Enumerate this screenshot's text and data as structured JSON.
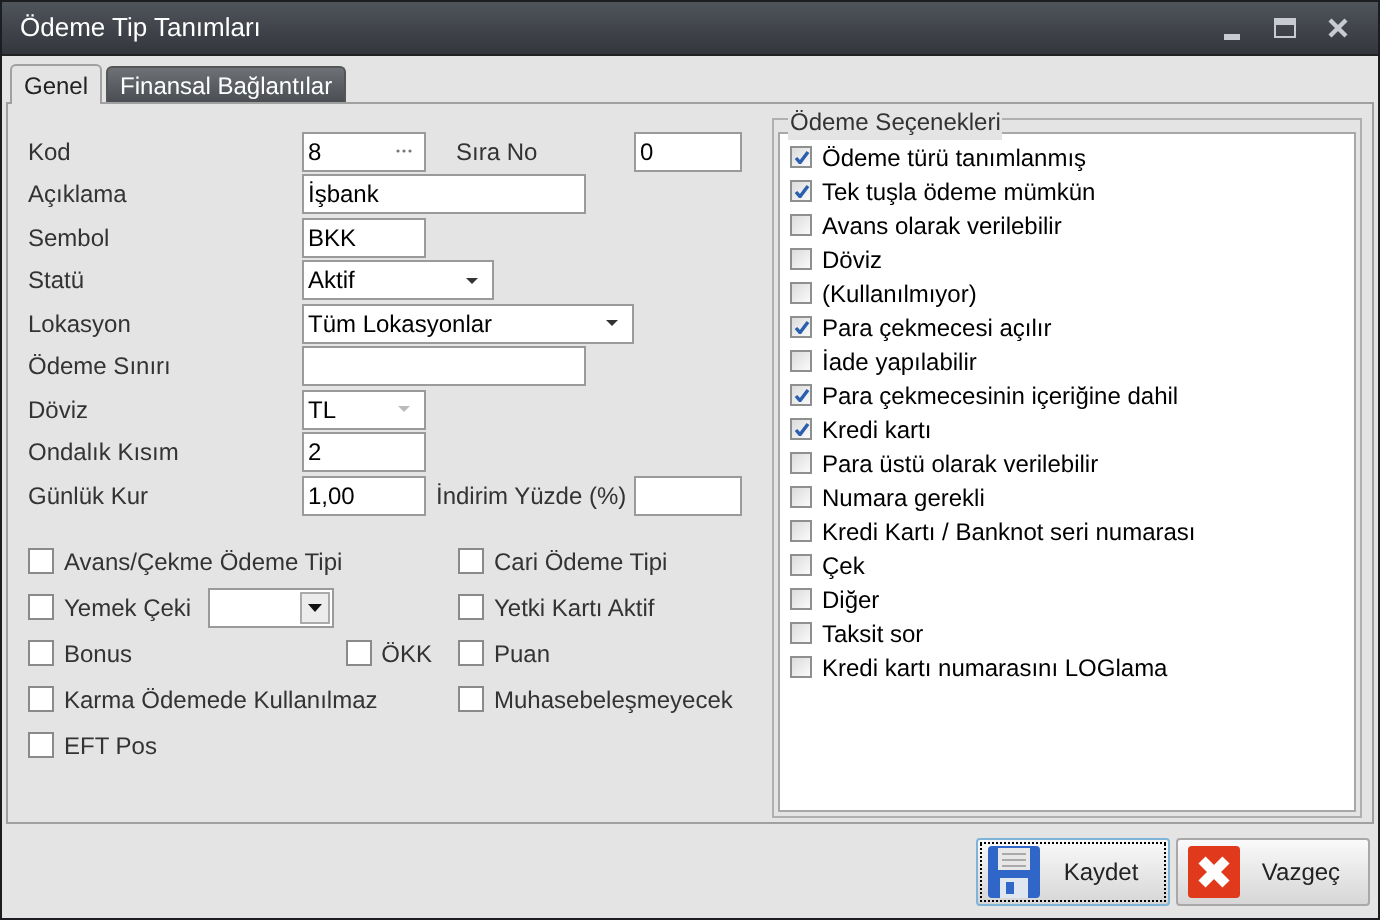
{
  "window": {
    "title": "Ödeme Tip Tanımları"
  },
  "tabs": [
    {
      "label": "Genel",
      "selected": true
    },
    {
      "label": "Finansal Bağlantılar",
      "selected": false
    }
  ],
  "fields": [
    {
      "label": "Kod",
      "kind": "lookup",
      "value": "8",
      "extra": {
        "label": "Sıra No",
        "value": "0"
      }
    },
    {
      "label": "Açıklama",
      "kind": "text-wide",
      "value": "İşbank"
    },
    {
      "label": "Sembol",
      "kind": "text",
      "value": "BKK"
    },
    {
      "label": "Statü",
      "kind": "select",
      "value": "Aktif"
    },
    {
      "label": "Lokasyon",
      "kind": "select-wide",
      "value": "Tüm Lokasyonlar"
    },
    {
      "label": "Ödeme Sınırı",
      "kind": "text-wide"
    },
    {
      "label": "Döviz",
      "kind": "select-disabled",
      "value": "TL"
    },
    {
      "label": "Ondalık Kısım",
      "kind": "text",
      "value": "2"
    },
    {
      "label": "Günlük Kur",
      "kind": "text",
      "value": "1,00",
      "extra": {
        "label": "İndirim Yüzde (%)"
      }
    }
  ],
  "flag_rows": [
    {
      "left": [
        {
          "label": "Avans/Çekme Ödeme Tipi",
          "checked": false
        }
      ],
      "right": [
        {
          "label": "Cari Ödeme Tipi",
          "checked": false
        }
      ]
    },
    {
      "left": [
        {
          "label": "Yemek Çeki",
          "checked": false,
          "kind": "dropdown"
        }
      ],
      "right": [
        {
          "label": "Yetki Kartı Aktif",
          "checked": false
        }
      ]
    },
    {
      "left": [
        {
          "label": "Bonus",
          "checked": false
        },
        {
          "label": "ÖKK",
          "checked": false
        }
      ],
      "right": [
        {
          "label": "Puan",
          "checked": false
        }
      ]
    },
    {
      "left": [
        {
          "label": "Karma Ödemede Kullanılmaz",
          "checked": false
        }
      ],
      "right": [
        {
          "label": "Muhasebeleşmeyecek",
          "checked": false
        }
      ]
    },
    {
      "left": [
        {
          "label": "EFT Pos",
          "checked": false
        }
      ],
      "right": []
    }
  ],
  "payment_options": {
    "title": "Ödeme Seçenekleri",
    "items": [
      {
        "label": "Ödeme türü tanımlanmış",
        "checked": true
      },
      {
        "label": "Tek tuşla ödeme mümkün",
        "checked": true
      },
      {
        "label": "Avans olarak verilebilir",
        "checked": false
      },
      {
        "label": "Döviz",
        "checked": false
      },
      {
        "label": "(Kullanılmıyor)",
        "checked": false
      },
      {
        "label": "Para çekmecesi açılır",
        "checked": true
      },
      {
        "label": "İade yapılabilir",
        "checked": false
      },
      {
        "label": "Para çekmecesinin içeriğine dahil",
        "checked": true
      },
      {
        "label": "Kredi kartı",
        "checked": true
      },
      {
        "label": "Para üstü olarak verilebilir",
        "checked": false
      },
      {
        "label": "Numara gerekli",
        "checked": false
      },
      {
        "label": "Kredi Kartı / Banknot seri numarası",
        "checked": false
      },
      {
        "label": "Çek",
        "checked": false
      },
      {
        "label": "Diğer",
        "checked": false
      },
      {
        "label": "Taksit sor",
        "checked": false
      },
      {
        "label": "Kredi kartı numarasını LOGlama",
        "checked": false
      }
    ]
  },
  "buttons": [
    {
      "label": "Kaydet",
      "kind": "save",
      "focused": true
    },
    {
      "label": "Vazgeç",
      "kind": "cancel",
      "focused": false
    }
  ]
}
